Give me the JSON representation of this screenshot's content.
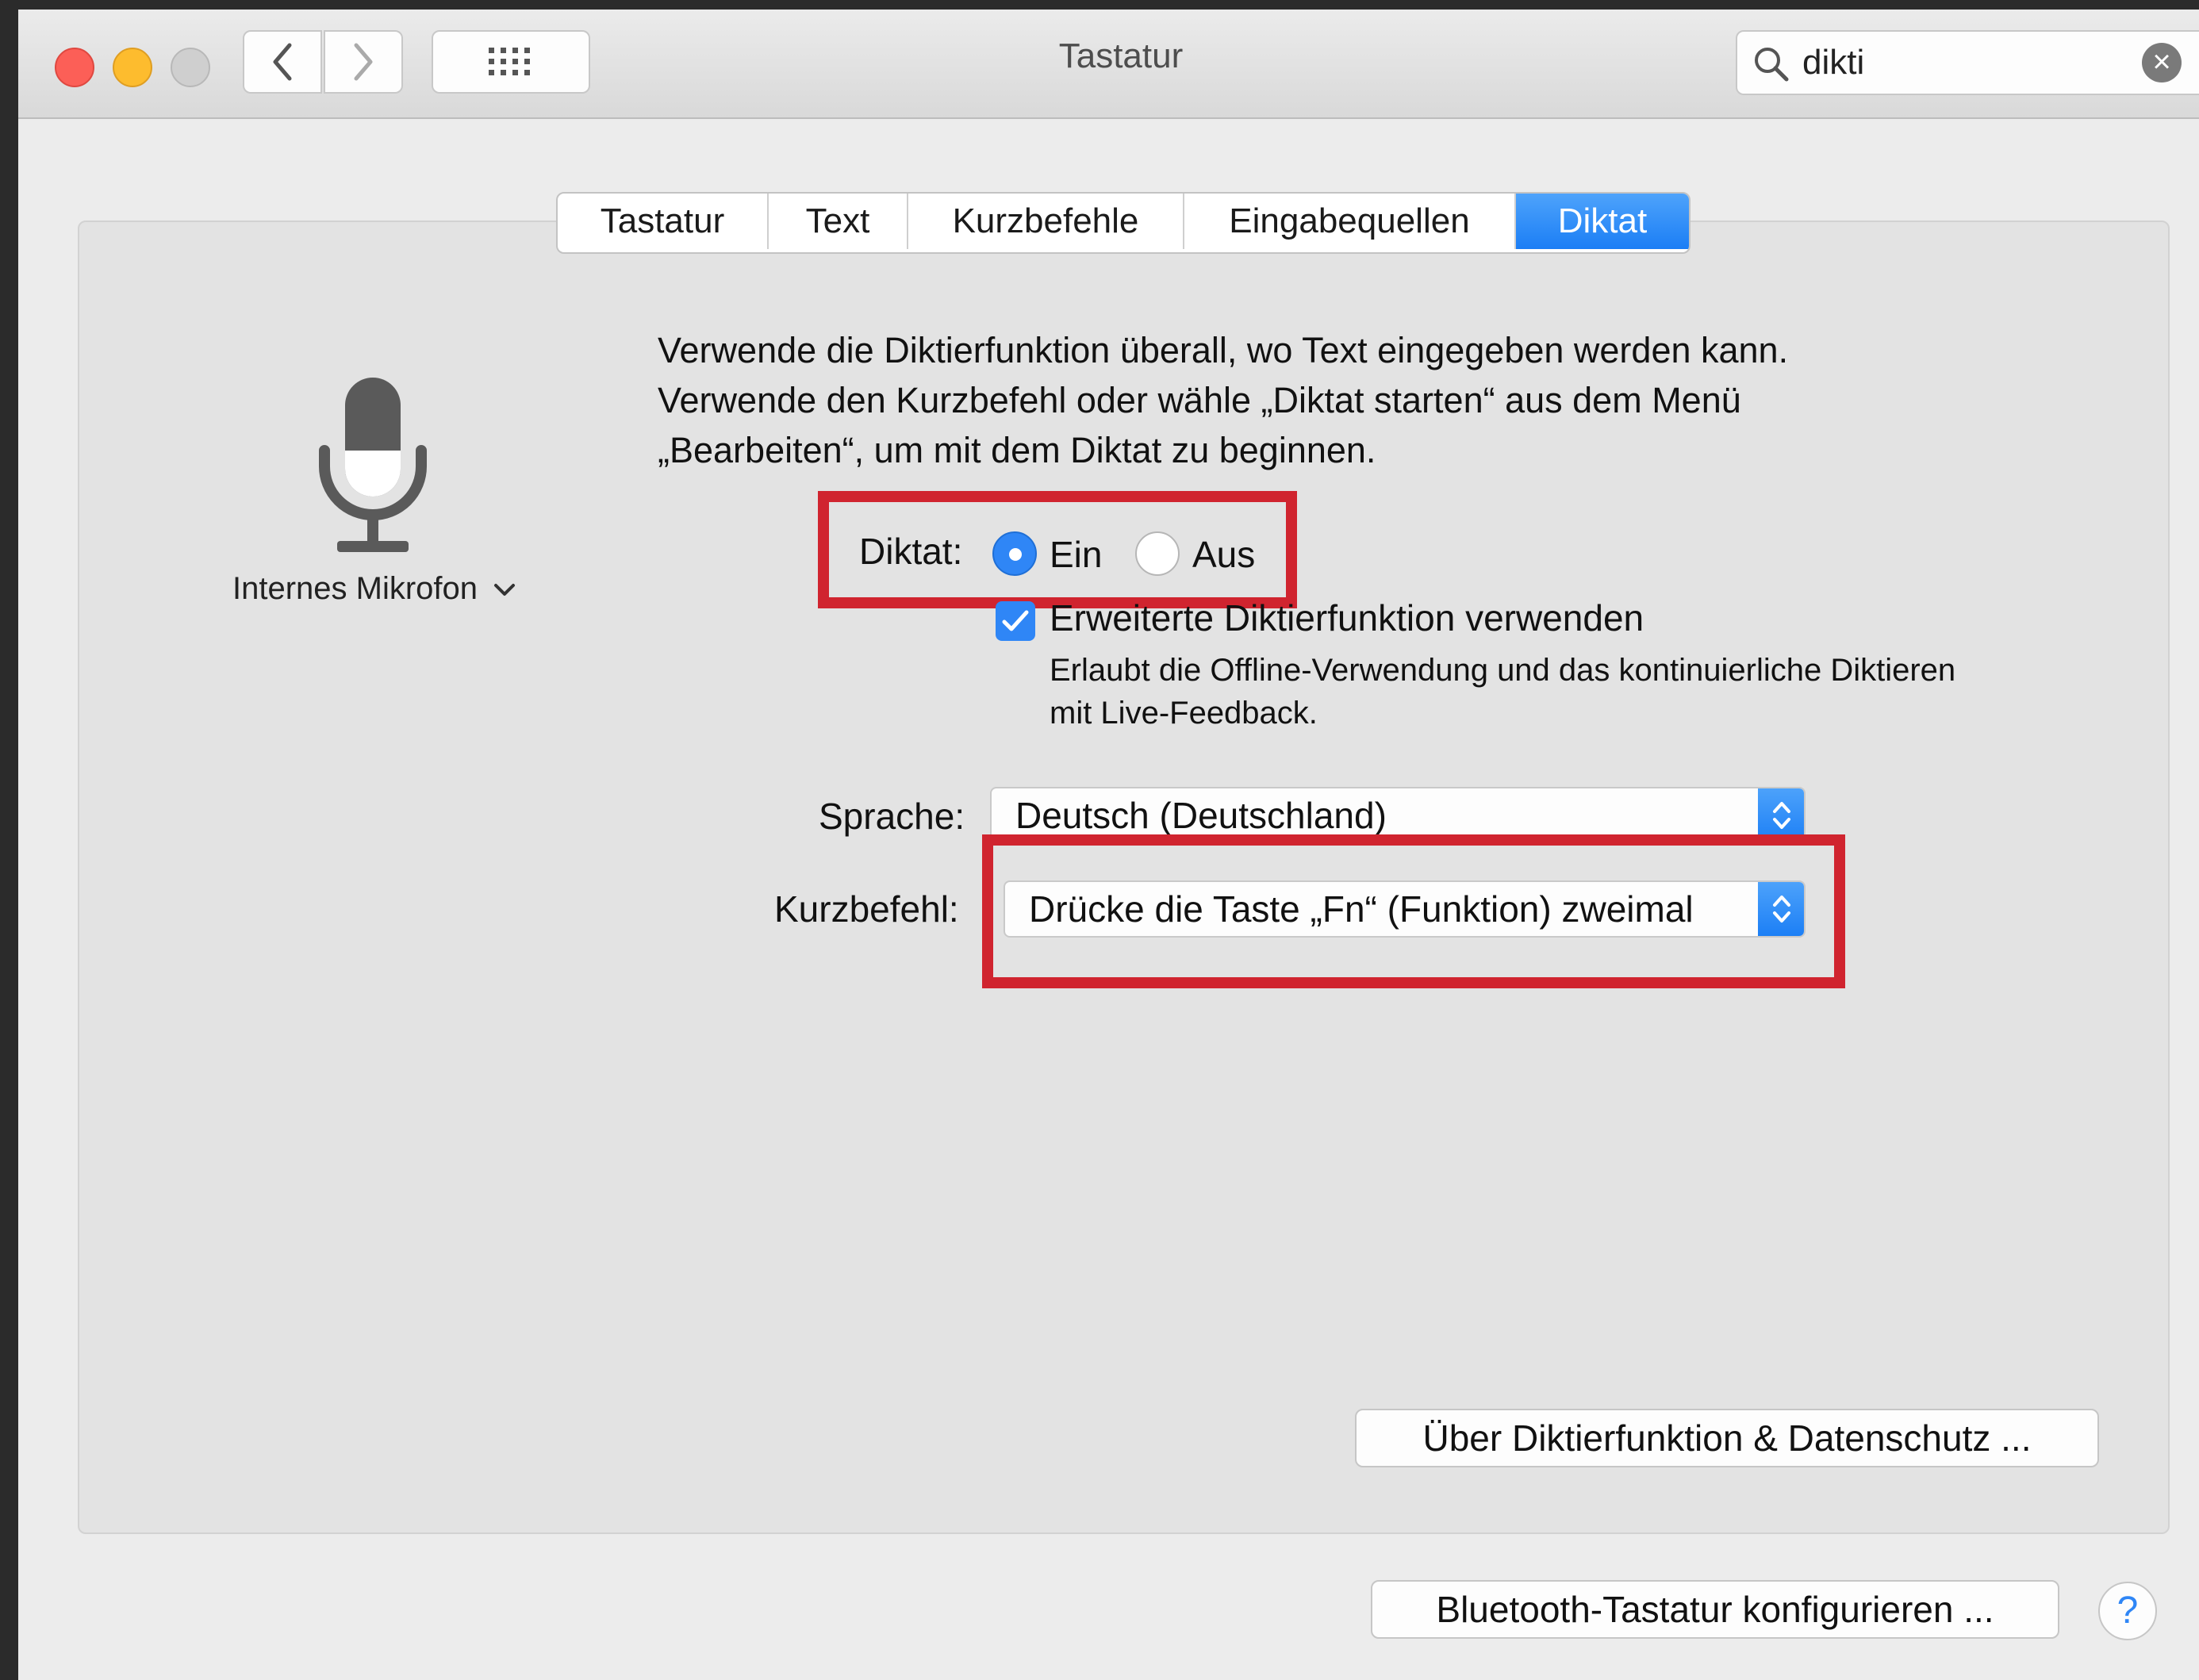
{
  "window": {
    "title": "Tastatur"
  },
  "search": {
    "value": "dikti"
  },
  "tabs": [
    {
      "label": "Tastatur",
      "active": false
    },
    {
      "label": "Text",
      "active": false
    },
    {
      "label": "Kurzbefehle",
      "active": false
    },
    {
      "label": "Eingabequellen",
      "active": false
    },
    {
      "label": "Diktat",
      "active": true
    }
  ],
  "mic": {
    "label": "Internes Mikrofon"
  },
  "description": [
    "Verwende die Diktierfunktion überall, wo Text eingegeben werden kann.",
    "Verwende den Kurzbefehl oder wähle „Diktat starten“ aus dem Menü",
    "„Bearbeiten“, um mit dem Diktat zu beginnen."
  ],
  "dictation": {
    "label": "Diktat:",
    "on_label": "Ein",
    "off_label": "Aus",
    "selected": "Ein"
  },
  "enhanced": {
    "label": "Erweiterte Diktierfunktion verwenden",
    "checked": true,
    "description": [
      "Erlaubt die Offline-Verwendung und das kontinuierliche Diktieren",
      "mit Live-Feedback."
    ]
  },
  "language": {
    "label": "Sprache:",
    "value": "Deutsch (Deutschland)"
  },
  "shortcut": {
    "label": "Kurzbefehl:",
    "value": "Drücke die Taste „Fn“ (Funktion) zweimal"
  },
  "buttons": {
    "privacy": "Über Diktierfunktion & Datenschutz ...",
    "bluetooth": "Bluetooth-Tastatur konfigurieren ...",
    "help": "?"
  },
  "colors": {
    "accent": "#2f86f6",
    "highlight": "#d0242f"
  }
}
